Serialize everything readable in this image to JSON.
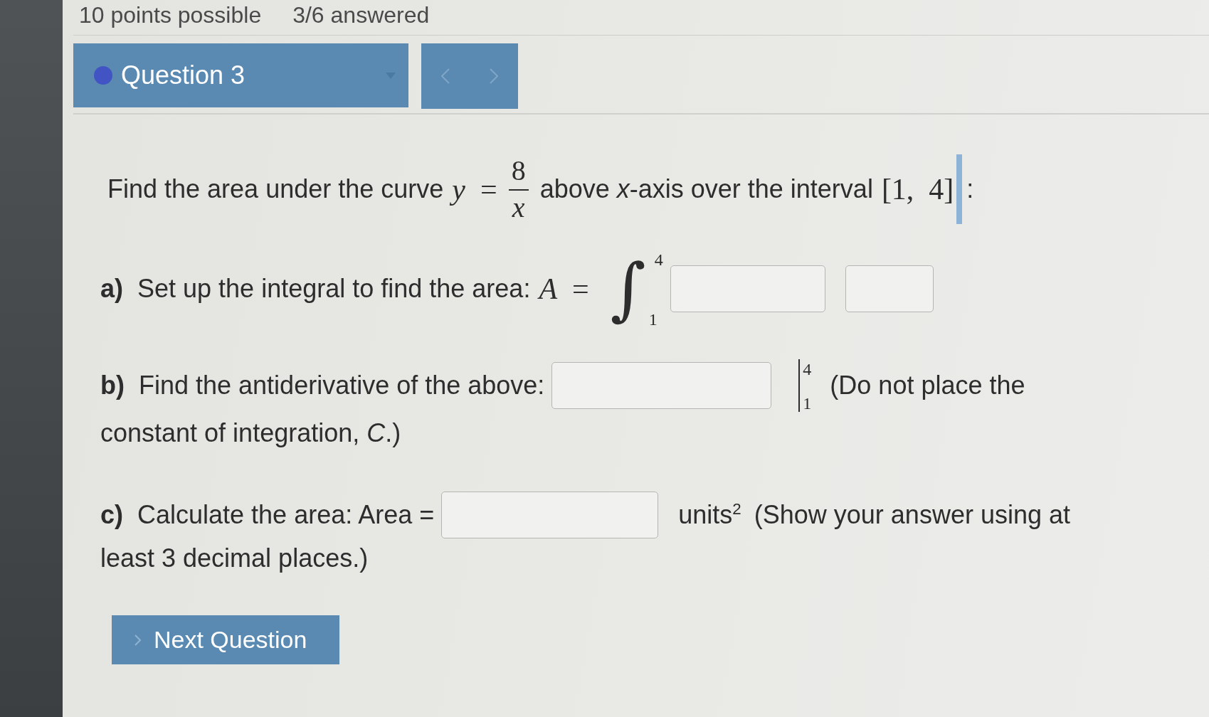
{
  "header_info": {
    "points": "10 points possible",
    "answered": "3/6 answered"
  },
  "question_bar": {
    "title": "Question 3"
  },
  "prompt": [
    {
      "kind": "text",
      "text": "Find the area under the curve"
    },
    {
      "kind": "math",
      "text": "*y* ="
    },
    {
      "kind": "fraction",
      "numerator": "8",
      "denominator": "x"
    },
    {
      "kind": "text",
      "text": "above *x*-axis over the interval"
    },
    {
      "kind": "math",
      "text": "[1, 4]"
    },
    {
      "kind": "cursor"
    },
    {
      "kind": "text",
      "text": ":"
    }
  ],
  "parts": [
    {
      "label": "a)",
      "segments": [
        {
          "kind": "text",
          "text": "Set up the integral to find the area:"
        },
        {
          "kind": "math",
          "text": "*A* ="
        },
        {
          "kind": "integral",
          "sign": "∫",
          "upper": "4",
          "lower": "1"
        },
        {
          "kind": "field"
        },
        {
          "kind": "field"
        }
      ]
    },
    {
      "label": "b)",
      "segments": [
        {
          "kind": "text",
          "text": "Find the antiderivative of the above:"
        },
        {
          "kind": "field"
        },
        {
          "kind": "evaluation",
          "upper": "4",
          "lower": "1"
        },
        {
          "kind": "text",
          "text": "(Do not place the"
        }
      ],
      "continuation": "constant of integration, *C*.)"
    },
    {
      "label": "c)",
      "segments": [
        {
          "kind": "text",
          "text": "Calculate the area: Area ="
        },
        {
          "kind": "field"
        },
        {
          "kind": "text",
          "text": "units$^{2}$"
        },
        {
          "kind": "text",
          "text": "(Show your answer using at"
        }
      ],
      "continuation": "least 3 decimal places.)"
    }
  ],
  "next_button": {
    "label": "Next Question"
  }
}
